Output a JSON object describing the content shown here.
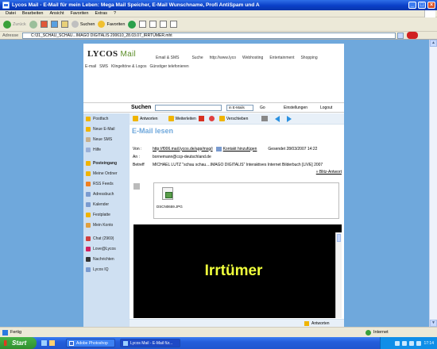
{
  "window": {
    "title": "Lycos Mail - E-Mail für mein Leben: Mega Mail Speicher, E-Mail Wunschname, Profi AntiSpam und A"
  },
  "menubar": [
    "Datei",
    "Bearbeiten",
    "Ansicht",
    "Favoriten",
    "Extras",
    "?"
  ],
  "toolbar": {
    "back": "Zurück",
    "search": "Suchen",
    "favorites": "Favoriten"
  },
  "address": {
    "label": "Adresse",
    "value": "C:\\31_SCHAU_SCHAU...IMAGO DIGITALIS 200610_28.03.07_IRRTÜMER.mht"
  },
  "lycos": {
    "logo_text": "LYCOS",
    "logo_mail": "Mail",
    "nav_top": [
      "Email & SMS",
      "Suche",
      "http://www.lyco",
      "Webhosting",
      "Entertainment",
      "Shopping"
    ],
    "nav_bottom": [
      "E-mail",
      "SMS",
      "Klingeltöne & Logos",
      "Günstiger telefonieren"
    ]
  },
  "search": {
    "label": "Suchen",
    "scope": "in E-Mails",
    "go": "Go",
    "settings": "Einstellungen",
    "logout": "Logout"
  },
  "sidebar": {
    "items": [
      {
        "label": "Postfach",
        "bold": false,
        "color": "#f0b400"
      },
      {
        "label": "Neue E-Mail",
        "bold": false,
        "color": "#f0b400"
      },
      {
        "label": "Neue SMS",
        "bold": false,
        "color": "#c7b08c"
      },
      {
        "label": "Hilfe",
        "bold": false,
        "color": "#9ab0d8"
      },
      {
        "label": "Posteingang",
        "bold": true,
        "color": "#f0b400"
      },
      {
        "label": "Meine Ordner",
        "bold": false,
        "color": "#f0b400"
      },
      {
        "label": "RSS Feeds",
        "bold": false,
        "color": "#f08020"
      },
      {
        "label": "Adressbuch",
        "bold": false,
        "color": "#7a9bd0"
      },
      {
        "label": "Kalender",
        "bold": false,
        "color": "#7a9bd0"
      },
      {
        "label": "Festplatte",
        "bold": false,
        "color": "#f0b400"
      },
      {
        "label": "Mein Konto",
        "bold": false,
        "color": "#e0a040"
      },
      {
        "label": "Chat (2969)",
        "bold": false,
        "color": "#d04040"
      },
      {
        "label": "Love@Lycos",
        "bold": false,
        "color": "#d02060"
      },
      {
        "label": "Nachrichten",
        "bold": false,
        "color": "#333333"
      },
      {
        "label": "Lycos IQ",
        "bold": false,
        "color": "#7a9bd0"
      }
    ]
  },
  "actions": {
    "reply": "Antworten",
    "forward": "Weiterleiten",
    "move": "Verschieben"
  },
  "message": {
    "heading": "E-Mail lesen",
    "from_label": "Von :",
    "from_value": "http://f006.mail.lycos.de/app/msg/i",
    "add_contact": "Kontakt hinzufügen",
    "sent": "Gesendet 28/03/2007 14:22",
    "to_label": "An :",
    "to_value": "bornemann@ccp-deutschland.de",
    "subject_label": "Betreff",
    "subject_value": "MICHAEL LUTZ \"schau schau....IMAGO DIGITALIS\" Interaktives Internet Bilderbuch [LIVE] 2007",
    "quick_reply": "» Blitz-Antwort",
    "attachment_name": "DSCN0659.JPG",
    "video_text": "Irrtümer",
    "bottom_reply": "Antworten"
  },
  "statusbar": {
    "left": "Fertig",
    "zone": "Internet"
  },
  "taskbar": {
    "start": "Start",
    "tasks": [
      "Adobe Photoshop",
      "Lycos Mail - E-Mail für..."
    ],
    "clock": "17:14"
  },
  "colors": {
    "page_bg": "#6fa8dc",
    "accent": "#6fa8dc",
    "video_text": "#f0ff3c"
  }
}
